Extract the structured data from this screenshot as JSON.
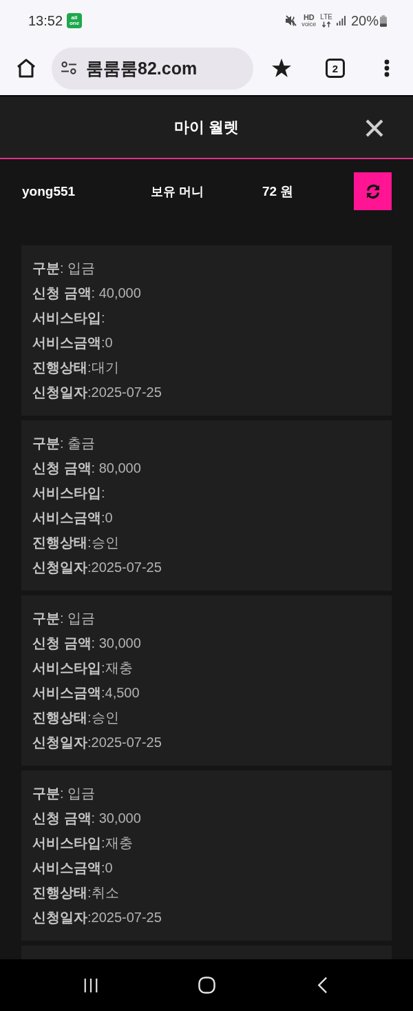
{
  "status_bar": {
    "time": "13:52",
    "app_badge": [
      "all",
      "one"
    ],
    "hd_label": "HD",
    "hd_sublabel": "voice",
    "network_label": "LTE",
    "battery_text": "20%"
  },
  "browser": {
    "url": "룸룸룸82.com",
    "tab_count": "2"
  },
  "wallet": {
    "title": "마이 월렛",
    "username": "yong551",
    "balance_label": "보유 머니",
    "balance": "72 원"
  },
  "transactions": [
    {
      "fields": [
        {
          "label": "구분",
          "value": ": 입금"
        },
        {
          "label": "신청 금액",
          "value": ": 40,000"
        },
        {
          "label": "서비스타입",
          "value": ":"
        },
        {
          "label": "서비스금액",
          "value": ":0"
        },
        {
          "label": "진행상태",
          "value": ":대기"
        },
        {
          "label": "신청일자",
          "value": ":2025-07-25"
        }
      ]
    },
    {
      "fields": [
        {
          "label": "구분",
          "value": ": 출금"
        },
        {
          "label": "신청 금액",
          "value": ": 80,000"
        },
        {
          "label": "서비스타입",
          "value": ":"
        },
        {
          "label": "서비스금액",
          "value": ":0"
        },
        {
          "label": "진행상태",
          "value": ":승인"
        },
        {
          "label": "신청일자",
          "value": ":2025-07-25"
        }
      ]
    },
    {
      "fields": [
        {
          "label": "구분",
          "value": ": 입금"
        },
        {
          "label": "신청 금액",
          "value": ": 30,000"
        },
        {
          "label": "서비스타입",
          "value": ":재충"
        },
        {
          "label": "서비스금액",
          "value": ":4,500"
        },
        {
          "label": "진행상태",
          "value": ":승인"
        },
        {
          "label": "신청일자",
          "value": ":2025-07-25"
        }
      ]
    },
    {
      "fields": [
        {
          "label": "구분",
          "value": ": 입금"
        },
        {
          "label": "신청 금액",
          "value": ": 30,000"
        },
        {
          "label": "서비스타입",
          "value": ":재충"
        },
        {
          "label": "서비스금액",
          "value": ":0"
        },
        {
          "label": "진행상태",
          "value": ":취소"
        },
        {
          "label": "신청일자",
          "value": ":2025-07-25"
        }
      ]
    }
  ]
}
